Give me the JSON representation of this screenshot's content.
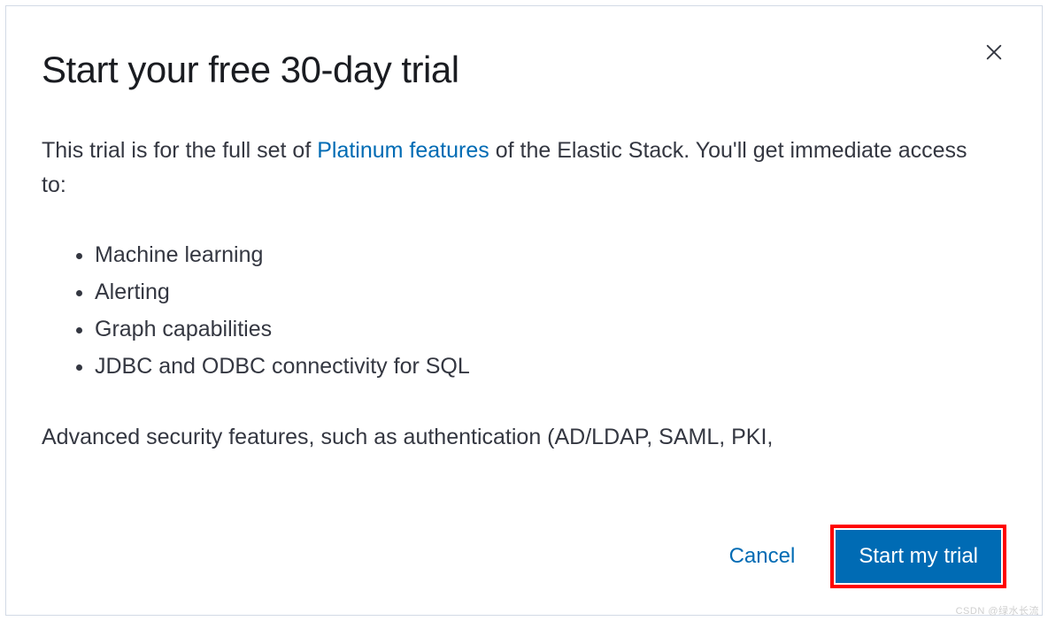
{
  "modal": {
    "title": "Start your free 30-day trial",
    "intro_before": "This trial is for the full set of ",
    "intro_link": "Platinum features",
    "intro_after": " of the Elastic Stack. You'll get immediate access to:",
    "features": [
      "Machine learning",
      "Alerting",
      "Graph capabilities",
      "JDBC and ODBC connectivity for SQL"
    ],
    "advanced_text": "Advanced security features, such as authentication (AD/LDAP, SAML, PKI,",
    "cancel_label": "Cancel",
    "start_label": "Start my trial"
  },
  "watermark": "CSDN @绿水长流"
}
